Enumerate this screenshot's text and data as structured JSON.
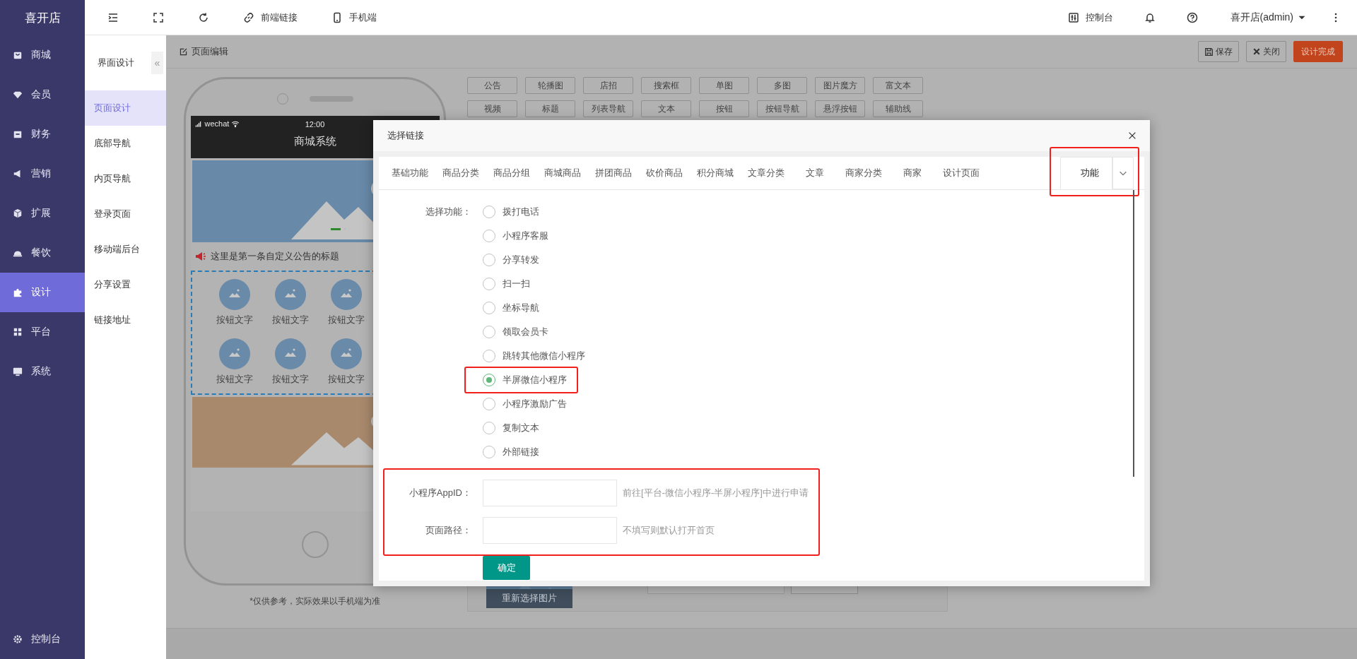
{
  "sidebar": {
    "logo": "喜开店",
    "items": [
      {
        "label": "商城",
        "selected": false
      },
      {
        "label": "会员",
        "selected": false
      },
      {
        "label": "财务",
        "selected": false
      },
      {
        "label": "营销",
        "selected": false
      },
      {
        "label": "扩展",
        "selected": false
      },
      {
        "label": "餐饮",
        "selected": false
      },
      {
        "label": "设计",
        "selected": true
      },
      {
        "label": "平台",
        "selected": false
      },
      {
        "label": "系统",
        "selected": false
      }
    ],
    "footer": "控制台"
  },
  "topbar": {
    "tools": [
      "前端链接",
      "手机端"
    ],
    "console": "控制台",
    "user": "喜开店(admin)"
  },
  "subnav": {
    "title": "界面设计",
    "collapse": "«",
    "items": [
      {
        "label": "页面设计",
        "selected": true
      },
      {
        "label": "底部导航",
        "selected": false
      },
      {
        "label": "内页导航",
        "selected": false
      },
      {
        "label": "登录页面",
        "selected": false
      },
      {
        "label": "移动端后台",
        "selected": false
      },
      {
        "label": "分享设置",
        "selected": false
      },
      {
        "label": "链接地址",
        "selected": false
      }
    ]
  },
  "editor": {
    "title": "页面编辑",
    "actions": [
      {
        "label": "保存",
        "kind": "save"
      },
      {
        "label": "关闭",
        "kind": "close"
      },
      {
        "label": "设计完成",
        "kind": "primary"
      }
    ]
  },
  "phone": {
    "carrier": "wechat",
    "time": "12:00",
    "title": "商城系统",
    "notice": "这里是第一条自定义公告的标题",
    "nav_buttons": [
      "按钮文字",
      "按钮文字",
      "按钮文字",
      "按钮文字",
      "按钮文字",
      "按钮文字"
    ],
    "caption": "*仅供参考，实际效果以手机端为准"
  },
  "component_rows": [
    [
      "公告",
      "轮播图",
      "店招",
      "搜索框",
      "单图",
      "多图",
      "图片魔方",
      "富文本"
    ],
    [
      "视频",
      "标题",
      "列表导航",
      "文本",
      "按钮",
      "按钮导航",
      "悬浮按钮",
      "辅助线"
    ]
  ],
  "image_panel": {
    "change_label": "重新选择图片"
  },
  "dialog": {
    "title": "选择链接",
    "tabs": [
      {
        "label": "基础功能",
        "selected": false
      },
      {
        "label": "商品分类",
        "selected": false
      },
      {
        "label": "商品分组",
        "selected": false
      },
      {
        "label": "商城商品",
        "selected": false
      },
      {
        "label": "拼团商品",
        "selected": false
      },
      {
        "label": "砍价商品",
        "selected": false
      },
      {
        "label": "积分商城",
        "selected": false
      },
      {
        "label": "文章分类",
        "selected": false
      },
      {
        "label": "文章",
        "selected": false
      },
      {
        "label": "商家分类",
        "selected": false
      },
      {
        "label": "商家",
        "selected": false
      },
      {
        "label": "设计页面",
        "selected": false
      },
      {
        "label": "功能",
        "selected": true
      }
    ],
    "tabs_end_highlighted": true,
    "function_label": "选择功能：",
    "options": [
      {
        "label": "拨打电话",
        "selected": false,
        "highlighted": false
      },
      {
        "label": "小程序客服",
        "selected": false,
        "highlighted": false
      },
      {
        "label": "分享转发",
        "selected": false,
        "highlighted": false
      },
      {
        "label": "扫一扫",
        "selected": false,
        "highlighted": false
      },
      {
        "label": "坐标导航",
        "selected": false,
        "highlighted": false
      },
      {
        "label": "领取会员卡",
        "selected": false,
        "highlighted": false
      },
      {
        "label": "跳转其他微信小程序",
        "selected": false,
        "highlighted": false
      },
      {
        "label": "半屏微信小程序",
        "selected": true,
        "highlighted": true
      },
      {
        "label": "小程序激励广告",
        "selected": false,
        "highlighted": false
      },
      {
        "label": "复制文本",
        "selected": false,
        "highlighted": false
      },
      {
        "label": "外部链接",
        "selected": false,
        "highlighted": false
      }
    ],
    "fields": [
      {
        "label": "小程序AppID：",
        "hint": "前往[平台-微信小程序-半屏小程序]中进行申请"
      },
      {
        "label": "页面路径：",
        "hint": "不填写则默认打开首页"
      }
    ],
    "fields_highlighted": true,
    "confirm": "确定"
  }
}
